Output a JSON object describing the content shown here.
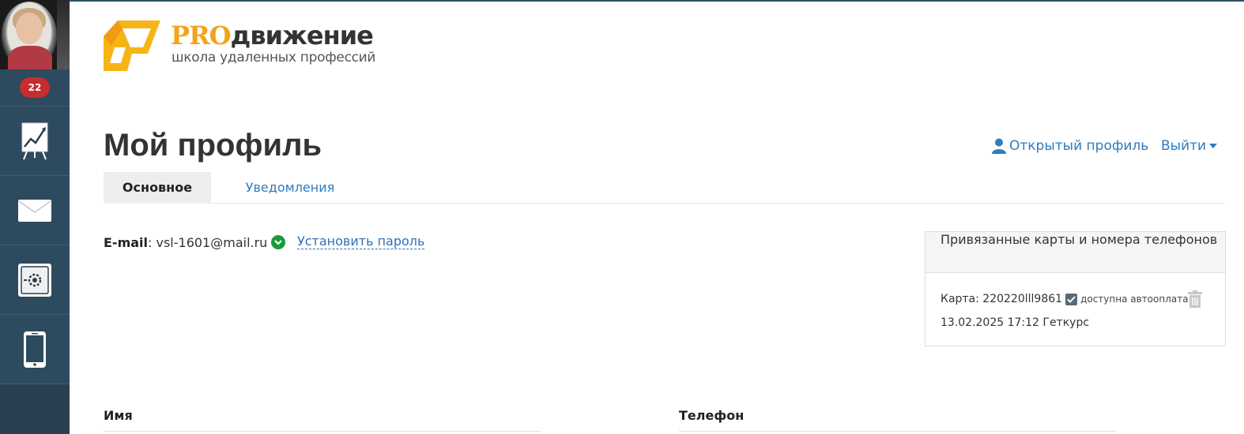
{
  "brand": {
    "title_pro": "PRO",
    "title_rest": "движение",
    "subtitle": "школа удаленных профессий",
    "accent_color": "#f4a31b"
  },
  "sidebar": {
    "badge_count": "22",
    "items": [
      {
        "icon": "presentation-chart-icon"
      },
      {
        "icon": "mail-icon"
      },
      {
        "icon": "safe-icon"
      },
      {
        "icon": "mobile-phone-icon"
      }
    ],
    "background": "#2e4a5e"
  },
  "header": {
    "title": "Мой профиль",
    "open_profile_label": "Открытый профиль",
    "logout_label": "Выйти"
  },
  "tabs": [
    {
      "label": "Основное",
      "active": true
    },
    {
      "label": "Уведомления",
      "active": false
    }
  ],
  "account": {
    "email_label": "E-mail",
    "email_value": ": vsl-1601@mail.ru",
    "set_password_label": "Установить пароль"
  },
  "cards_panel": {
    "title": "Привязанные карты и номера телефонов",
    "card_text": "Карта: 220220lll9861",
    "autopay_label": "доступна автооплата",
    "date_text": "13.02.2025 17:12 Геткурс"
  },
  "fields": {
    "name_label": "Имя",
    "phone_label": "Телефон"
  },
  "colors": {
    "link": "#2f7cbf",
    "badge": "#c62d2d",
    "verified": "#1a9a3a"
  }
}
